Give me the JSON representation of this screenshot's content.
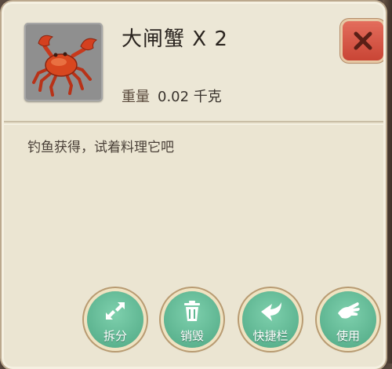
{
  "item": {
    "name": "大闸蟹 X 2",
    "weight_label": "重量",
    "weight_value": "0.02 千克",
    "description": "钓鱼获得，试着料理它吧",
    "icon": "crab-icon"
  },
  "close": {
    "icon": "close-icon",
    "color": "#d65846"
  },
  "actions": [
    {
      "label": "拆分",
      "icon": "split-arrows-icon"
    },
    {
      "label": "销毁",
      "icon": "trash-icon"
    },
    {
      "label": "快捷栏",
      "icon": "arrow-left-icon"
    },
    {
      "label": "使用",
      "icon": "hand-icon"
    }
  ],
  "colors": {
    "panel": "#ebe5d2",
    "button": "#5fb892",
    "accent": "#d65846"
  }
}
